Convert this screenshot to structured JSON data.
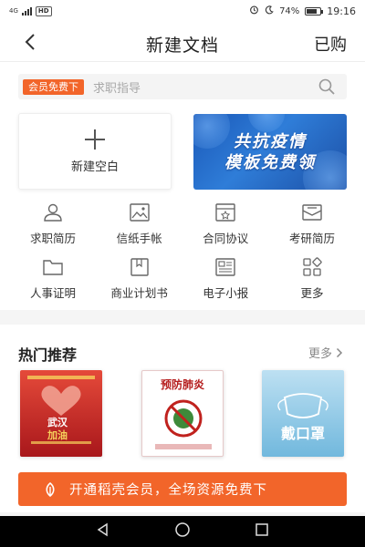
{
  "status_bar": {
    "network": "4G",
    "hd": "HD",
    "battery": "74%",
    "time": "19:16"
  },
  "header": {
    "title": "新建文档",
    "purchased": "已购"
  },
  "search": {
    "tag": "会员免费下",
    "placeholder": "求职指导"
  },
  "new_blank": {
    "label": "新建空白"
  },
  "banner": {
    "line1": "共抗疫情",
    "line2": "模板免费领"
  },
  "categories": [
    {
      "label": "求职简历",
      "icon": "person-icon"
    },
    {
      "label": "信纸手帐",
      "icon": "image-icon"
    },
    {
      "label": "合同协议",
      "icon": "contract-icon"
    },
    {
      "label": "考研简历",
      "icon": "inbox-icon"
    },
    {
      "label": "人事证明",
      "icon": "folder-icon"
    },
    {
      "label": "商业计划书",
      "icon": "book-icon"
    },
    {
      "label": "电子小报",
      "icon": "newspaper-icon"
    },
    {
      "label": "更多",
      "icon": "more-grid-icon"
    }
  ],
  "recommend": {
    "title": "热门推荐",
    "more": "更多",
    "templates": [
      {
        "top": "武汉",
        "bottom": "加油"
      },
      {
        "top": "预防肺炎"
      },
      {
        "top": "戴口罩"
      }
    ]
  },
  "vip_bar": {
    "text": "开通稻壳会员，全场资源免费下"
  },
  "colors": {
    "accent": "#f2652a",
    "banner_blue": "#1a58b8"
  }
}
